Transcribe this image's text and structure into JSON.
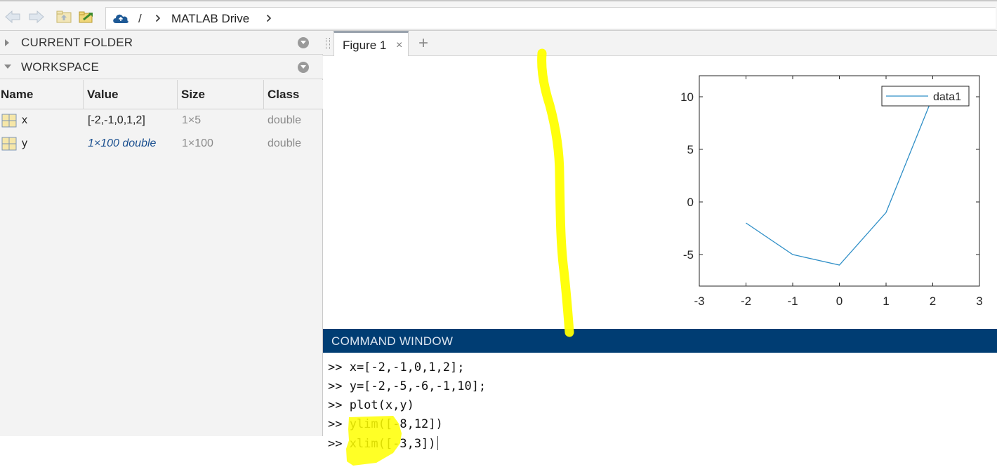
{
  "address_bar": {
    "root_separator": "/",
    "crumb": "MATLAB Drive"
  },
  "left_panel": {
    "sections": [
      {
        "label": "CURRENT FOLDER",
        "expanded": false
      },
      {
        "label": "WORKSPACE",
        "expanded": true
      }
    ],
    "workspace": {
      "columns": [
        "Name",
        "Value",
        "Size",
        "Class"
      ],
      "rows": [
        {
          "name": "x",
          "value": "[-2,-1,0,1,2]",
          "size": "1×5",
          "class": "double"
        },
        {
          "name": "y",
          "value": "1×100 double",
          "size": "1×100",
          "class": "double"
        }
      ]
    }
  },
  "figure": {
    "tab_label": "Figure 1",
    "close_glyph": "×",
    "add_glyph": "+"
  },
  "chart_data": {
    "type": "line",
    "x": [
      -2,
      -1,
      0,
      1,
      2
    ],
    "series": [
      {
        "name": "data1",
        "values": [
          -2,
          -5,
          -6,
          -1,
          10
        ],
        "color": "#2f8fc7"
      }
    ],
    "xlim": [
      -3,
      3
    ],
    "ylim": [
      -8,
      12
    ],
    "xticks": [
      -3,
      -2,
      -1,
      0,
      1,
      2,
      3
    ],
    "yticks": [
      -5,
      0,
      5,
      10
    ],
    "grid": false,
    "legend_position": "top-right"
  },
  "command_window": {
    "title": "COMMAND WINDOW",
    "lines": [
      ">> x=[-2,-1,0,1,2];",
      ">> y=[-2,-5,-6,-1,10];",
      ">> plot(x,y)",
      ">> ylim([-8,12])",
      ">> xlim([-3,3])"
    ]
  },
  "colors": {
    "command_header": "#003d73",
    "highlight": "#ffff00",
    "plot_line": "#2f8fc7"
  },
  "icons": [
    "back-arrow-icon",
    "forward-arrow-icon",
    "up-folder-icon",
    "browse-folder-icon",
    "cloud-drive-icon",
    "chevron-right-icon",
    "collapse-triangle-icon",
    "options-icon",
    "variable-grid-icon"
  ]
}
